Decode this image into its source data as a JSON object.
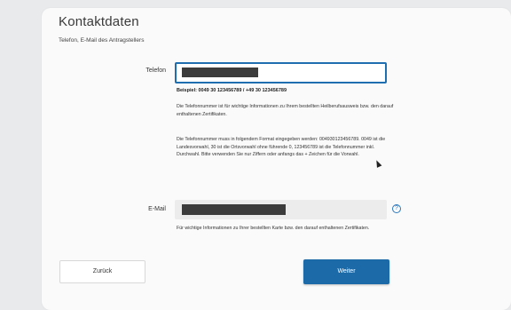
{
  "section": {
    "title": "Kontaktdaten",
    "subtitle": "Telefon, E-Mail des Antragstellers"
  },
  "phone": {
    "label": "Telefon",
    "example": "Beispiel: 0049 30 123456789 / +49 30 123456789",
    "info1": "Die Telefonnummer ist für wichtige Informationen zu Ihrem bestellten Heilberufsausweis bzw. den darauf enthaltenen Zertifikaten.",
    "info2": "Die Telefonnummer muss in folgendem Format eingegeben werden: 004930123456789. 0049 ist die Landesvorwahl, 30 ist die Ortsvorwahl ohne führende 0, 123456789 ist die Telefonnummer inkl. Durchwahl. Bitte verwenden Sie nur Ziffern oder anfangs das + Zeichen für die Vorwahl."
  },
  "email": {
    "label": "E-Mail",
    "info": "Für wichtige Informationen zu Ihrer bestellten Karte bzw. den darauf enthaltenen Zertifikaten.",
    "help_icon": "question-circle-icon"
  },
  "buttons": {
    "back": "Zurück",
    "next": "Weiter"
  },
  "colors": {
    "accent": "#1d6aa9",
    "focus_border": "#1f6fb0"
  }
}
